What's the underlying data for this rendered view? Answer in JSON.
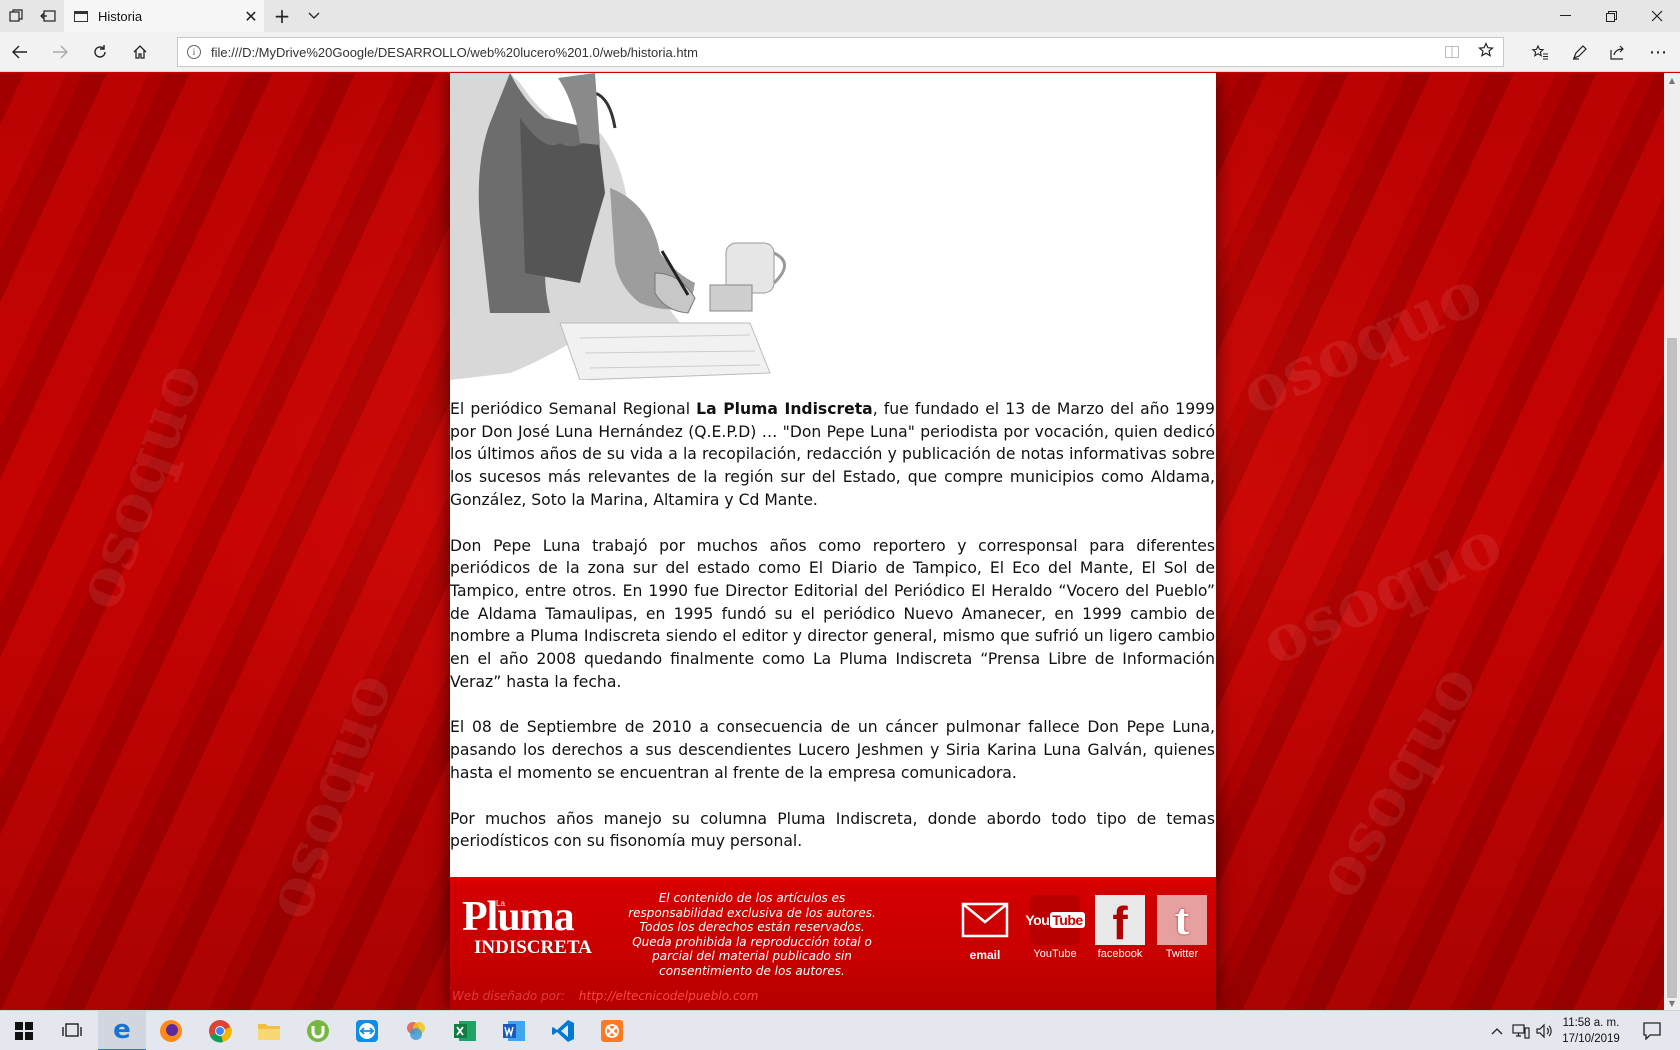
{
  "browser": {
    "tab_title": "Historia",
    "url": "file:///D:/MyDrive%20Google/DESARROLLO/web%20lucero%201.0/web/historia.htm"
  },
  "article": {
    "p1_pre": "El periódico Semanal Regional ",
    "p1_brand": "La Pluma Indiscreta",
    "p1_post": ", fue fundado el 13 de Marzo del año 1999 por Don José Luna Hernández (Q.E.P.D) … \"Don Pepe Luna\" periodista por vocación, quien dedicó los últimos años de su vida a la recopilación, redacción y publicación de notas informativas sobre los sucesos más relevantes de la región sur del Estado, que compre municipios como Aldama, González, Soto la Marina, Altamira y Cd Mante.",
    "p2": "Don Pepe Luna trabajó por muchos años como reportero y corresponsal para diferentes periódicos de la zona sur del estado como El Diario de Tampico, El Eco del Mante, El Sol de Tampico, entre otros. En 1990 fue Director Editorial del Periódico El Heraldo “Vocero del Pueblo” de Aldama Tamaulipas, en 1995 fundó su el periódico  Nuevo Amanecer, en 1999 cambio de nombre a Pluma Indiscreta siendo el editor y director general, mismo que sufrió un ligero cambio en el año 2008 quedando finalmente como La Pluma Indiscreta “Prensa Libre de Información Veraz” hasta la fecha.",
    "p3": "El 08 de Septiembre de 2010 a consecuencia de un cáncer pulmonar fallece Don Pepe Luna, pasando los derechos a sus descendientes Lucero Jeshmen y Siria Karina Luna Galván, quienes hasta el momento se encuentran al frente de la empresa comunicadora.",
    "p4": "Por muchos años manejo su columna Pluma Indiscreta, donde abordo todo tipo de temas periodísticos con su fisonomía muy personal."
  },
  "footer": {
    "logo_la": "La",
    "logo_pluma": "Pluma",
    "logo_indiscreta": "INDISCRETA",
    "disclaimer": "El contenido de los artículos es responsabilidad exclusiva de los autores. Todos los derechos están reservados. Queda prohibida la reproducción total o parcial del material publicado sin consentimiento de los autores.",
    "social": {
      "email": "email",
      "youtube": "YouTube",
      "facebook": "facebook",
      "twitter": "Twitter"
    },
    "youtube_logo_text": "You",
    "youtube_logo_tube": "Tube",
    "credit_label": "Web diseñado por:",
    "credit_link": "http://eltecnicodelpueblo.com"
  },
  "taskbar": {
    "time": "11:58 a. m.",
    "date": "17/10/2019"
  },
  "colors": {
    "page_red": "#c00000",
    "footer_red": "#d40000",
    "brand_accent": "#ff4545"
  }
}
